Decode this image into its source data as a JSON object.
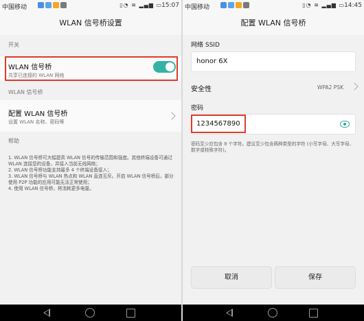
{
  "left": {
    "status": {
      "carrier": "中国移动",
      "time": "15:07"
    },
    "title": "WLAN 信号桥设置",
    "section_switch": "开关",
    "toggle_row": {
      "title": "WLAN 信号桥",
      "subtitle": "共享已连接的 WLAN 网络",
      "on": true
    },
    "section_bridge": "WLAN 信号桥",
    "config_row": {
      "title": "配置 WLAN 信号桥",
      "subtitle": "设置 WLAN 名称、密码等"
    },
    "section_help": "帮助",
    "help_lines": [
      "1. WLAN 信号桥可大幅提高 WLAN 信号的传输范围和强度。其他终端设备可通过 WLAN 连接您的设备，并接入当前无线网络；",
      "2. WLAN 信号桥功能支持最多 4 个终端设备接入；",
      "3. WLAN 信号桥与 WLAN 热点和 WLAN 直连互斥。开启 WLAN 信号桥后，部分使用 P2P 功能的应用可能无法正常使用；",
      "4. 使用 WLAN 信号桥，将消耗更多电量。"
    ]
  },
  "right": {
    "status": {
      "carrier": "中国移动",
      "time": "14:45"
    },
    "title": "配置 WLAN 信号桥",
    "ssid_label": "网络 SSID",
    "ssid_value": "honor 6X",
    "security_label": "安全性",
    "security_value": "WPA2 PSK",
    "password_label": "密码",
    "password_value": "1234567890",
    "password_hint": "密码至少应包含 8 个字符。建议至少包含两种类型的字符 (小写字母、大写字母、数字或特殊字符)。",
    "cancel_label": "取消",
    "save_label": "保存"
  },
  "colors": {
    "accent": "#33b2a5",
    "highlight": "#e03a2a"
  }
}
